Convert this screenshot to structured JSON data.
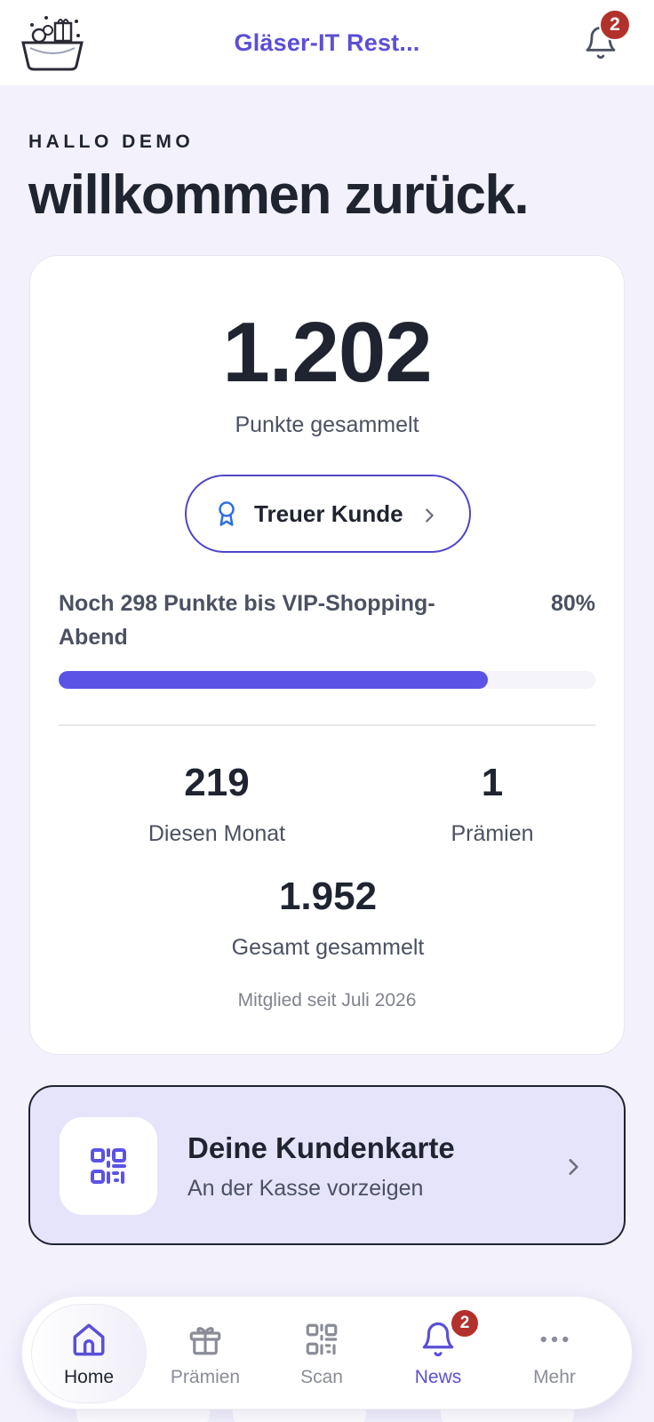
{
  "header": {
    "title": "Gläser-IT Rest...",
    "notification_count": "2",
    "logo_icon": "gift-basket-logo",
    "bell_icon": "bell-icon"
  },
  "greeting": {
    "hello": "HALLO DEMO",
    "welcome": "willkommen zurück."
  },
  "points_card": {
    "points": "1.202",
    "points_label": "Punkte gesammelt",
    "tier": "Treuer Kunde",
    "progress_text": "Noch 298 Punkte bis VIP-Shopping-Abend",
    "progress_percent_label": "80%",
    "progress_fraction": 0.8,
    "stats": {
      "month_value": "219",
      "month_label": "Diesen Monat",
      "rewards_value": "1",
      "rewards_label": "Prämien",
      "total_value": "1.952",
      "total_label": "Gesamt gesammelt"
    },
    "member_since": "Mitglied seit Juli 2026"
  },
  "customer_card": {
    "title": "Deine Kundenkarte",
    "subtitle": "An der Kasse vorzeigen"
  },
  "bottom_nav": {
    "items": [
      {
        "label": "Home",
        "icon": "home-icon",
        "active": true
      },
      {
        "label": "Prämien",
        "icon": "gift-icon"
      },
      {
        "label": "Scan",
        "icon": "qr-scan-icon"
      },
      {
        "label": "News",
        "icon": "bell-icon",
        "badge": "2"
      },
      {
        "label": "Mehr",
        "icon": "more-dots-icon"
      }
    ]
  },
  "colors": {
    "accent": "#5b4fd6",
    "progress": "#5b53e6",
    "badge": "#b3312c",
    "background": "#f3f2fc",
    "customer_card_bg": "#e6e4fb"
  }
}
